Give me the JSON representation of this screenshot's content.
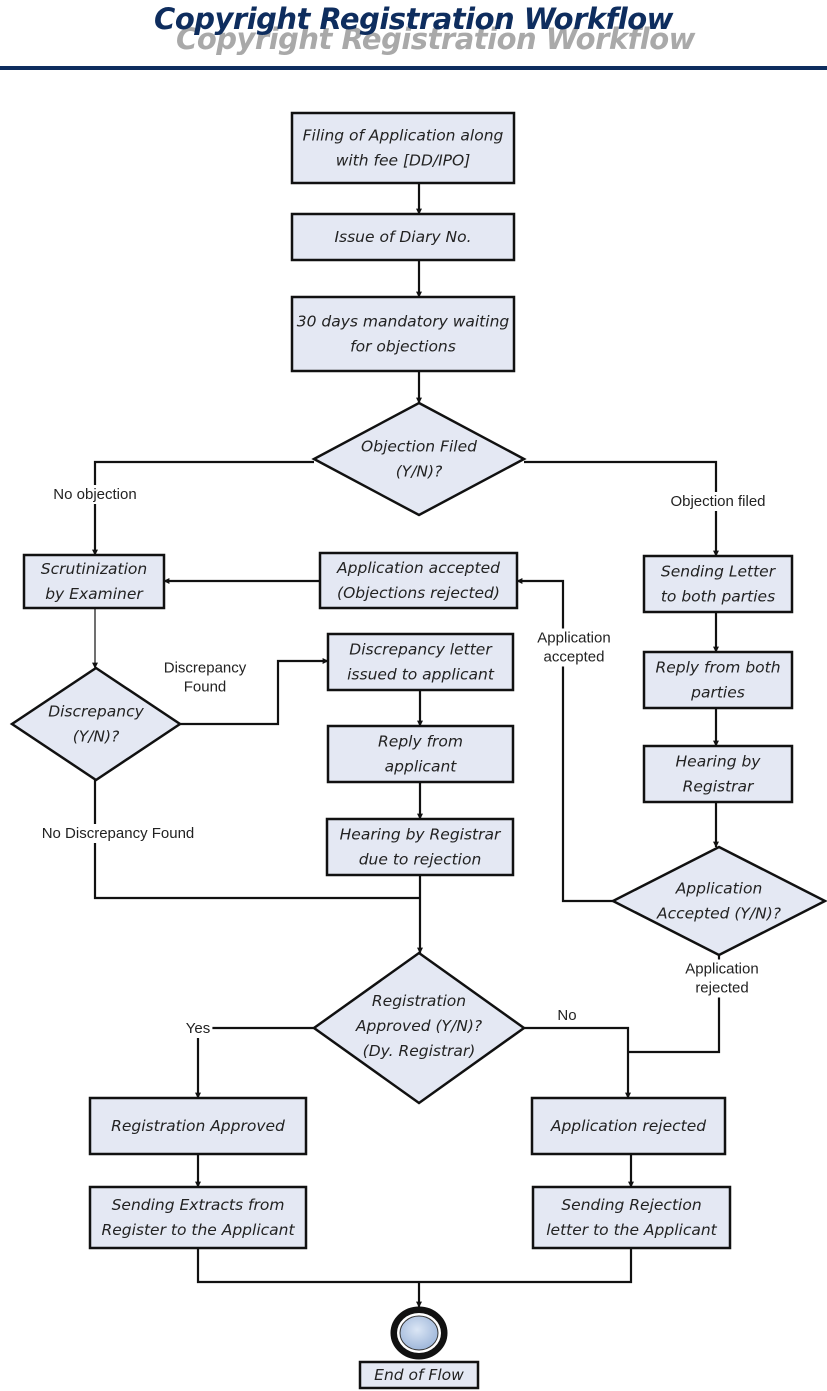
{
  "title": "Copyright Registration Workflow",
  "colors": {
    "title": "#0e2d5e",
    "title_shadow": "#a9a9a9",
    "node_fill": "#e4e8f3",
    "stroke": "#111111",
    "end_circle": "#b8cbe6"
  },
  "nodes": {
    "filing": {
      "type": "process",
      "lines": [
        "Filing of Application along",
        "with fee [DD/IPO]"
      ]
    },
    "diary": {
      "type": "process",
      "lines": [
        "Issue of Diary No."
      ]
    },
    "waiting": {
      "type": "process",
      "lines": [
        "30 days mandatory waiting",
        "for objections"
      ]
    },
    "objection_decision": {
      "type": "decision",
      "lines": [
        "Objection Filed",
        "(Y/N)?"
      ]
    },
    "scrutiny": {
      "type": "process",
      "lines": [
        "Scrutinization",
        "by Examiner"
      ]
    },
    "app_accepted": {
      "type": "process",
      "lines": [
        "Application accepted",
        "(Objections rejected)"
      ]
    },
    "sending_letter": {
      "type": "process",
      "lines": [
        "Sending Letter",
        "to both parties"
      ]
    },
    "discrepancy_decision": {
      "type": "decision",
      "lines": [
        "Discrepancy",
        "(Y/N)?"
      ]
    },
    "discrepancy_letter": {
      "type": "process",
      "lines": [
        "Discrepancy letter",
        "issued to applicant"
      ]
    },
    "reply_applicant": {
      "type": "process",
      "lines": [
        "Reply from",
        "applicant"
      ]
    },
    "hearing_rejection": {
      "type": "process",
      "lines": [
        "Hearing by Registrar",
        "due to rejection"
      ]
    },
    "reply_both": {
      "type": "process",
      "lines": [
        "Reply from both",
        "parties"
      ]
    },
    "hearing_registrar": {
      "type": "process",
      "lines": [
        "Hearing by",
        "Registrar"
      ]
    },
    "accepted_decision": {
      "type": "decision",
      "lines": [
        "Application",
        "Accepted (Y/N)?"
      ]
    },
    "registration_decision": {
      "type": "decision",
      "lines": [
        "Registration",
        "Approved (Y/N)?",
        "(Dy. Registrar)"
      ]
    },
    "reg_approved": {
      "type": "process",
      "lines": [
        "Registration Approved"
      ]
    },
    "app_rejected": {
      "type": "process",
      "lines": [
        "Application rejected"
      ]
    },
    "sending_extracts": {
      "type": "process",
      "lines": [
        "Sending Extracts from",
        "Register to the Applicant"
      ]
    },
    "sending_rejection": {
      "type": "process",
      "lines": [
        "Sending Rejection",
        "letter to the Applicant"
      ]
    },
    "end": {
      "type": "end",
      "lines": [
        "End of Flow"
      ]
    }
  },
  "edges": [
    {
      "from": "filing",
      "to": "diary",
      "label": ""
    },
    {
      "from": "diary",
      "to": "waiting",
      "label": ""
    },
    {
      "from": "waiting",
      "to": "objection_decision",
      "label": ""
    },
    {
      "from": "objection_decision",
      "to": "scrutiny",
      "label": "No objection"
    },
    {
      "from": "objection_decision",
      "to": "sending_letter",
      "label": "Objection filed"
    },
    {
      "from": "app_accepted",
      "to": "scrutiny",
      "label": ""
    },
    {
      "from": "scrutiny",
      "to": "discrepancy_decision",
      "label": ""
    },
    {
      "from": "discrepancy_decision",
      "to": "discrepancy_letter",
      "label": "Discrepancy Found"
    },
    {
      "from": "discrepancy_decision",
      "to": "registration_decision",
      "label": "No Discrepancy Found"
    },
    {
      "from": "discrepancy_letter",
      "to": "reply_applicant",
      "label": ""
    },
    {
      "from": "reply_applicant",
      "to": "hearing_rejection",
      "label": ""
    },
    {
      "from": "hearing_rejection",
      "to": "registration_decision",
      "label": ""
    },
    {
      "from": "sending_letter",
      "to": "reply_both",
      "label": ""
    },
    {
      "from": "reply_both",
      "to": "hearing_registrar",
      "label": ""
    },
    {
      "from": "hearing_registrar",
      "to": "accepted_decision",
      "label": ""
    },
    {
      "from": "accepted_decision",
      "to": "app_accepted",
      "label": "Application accepted"
    },
    {
      "from": "accepted_decision",
      "to": "app_rejected",
      "label": "Application rejected"
    },
    {
      "from": "registration_decision",
      "to": "reg_approved",
      "label": "Yes"
    },
    {
      "from": "registration_decision",
      "to": "app_rejected",
      "label": "No"
    },
    {
      "from": "reg_approved",
      "to": "sending_extracts",
      "label": ""
    },
    {
      "from": "app_rejected",
      "to": "sending_rejection",
      "label": ""
    },
    {
      "from": "sending_extracts",
      "to": "end",
      "label": ""
    },
    {
      "from": "sending_rejection",
      "to": "end",
      "label": ""
    }
  ],
  "edge_labels": {
    "no_objection": [
      "No objection"
    ],
    "objection_filed": [
      "Objection filed"
    ],
    "discrepancy_found": [
      "Discrepancy",
      "Found"
    ],
    "no_discrepancy": [
      "No Discrepancy Found"
    ],
    "application_accepted": [
      "Application",
      "accepted"
    ],
    "application_rejected": [
      "Application",
      "rejected"
    ],
    "yes": [
      "Yes"
    ],
    "no": [
      "No"
    ]
  }
}
